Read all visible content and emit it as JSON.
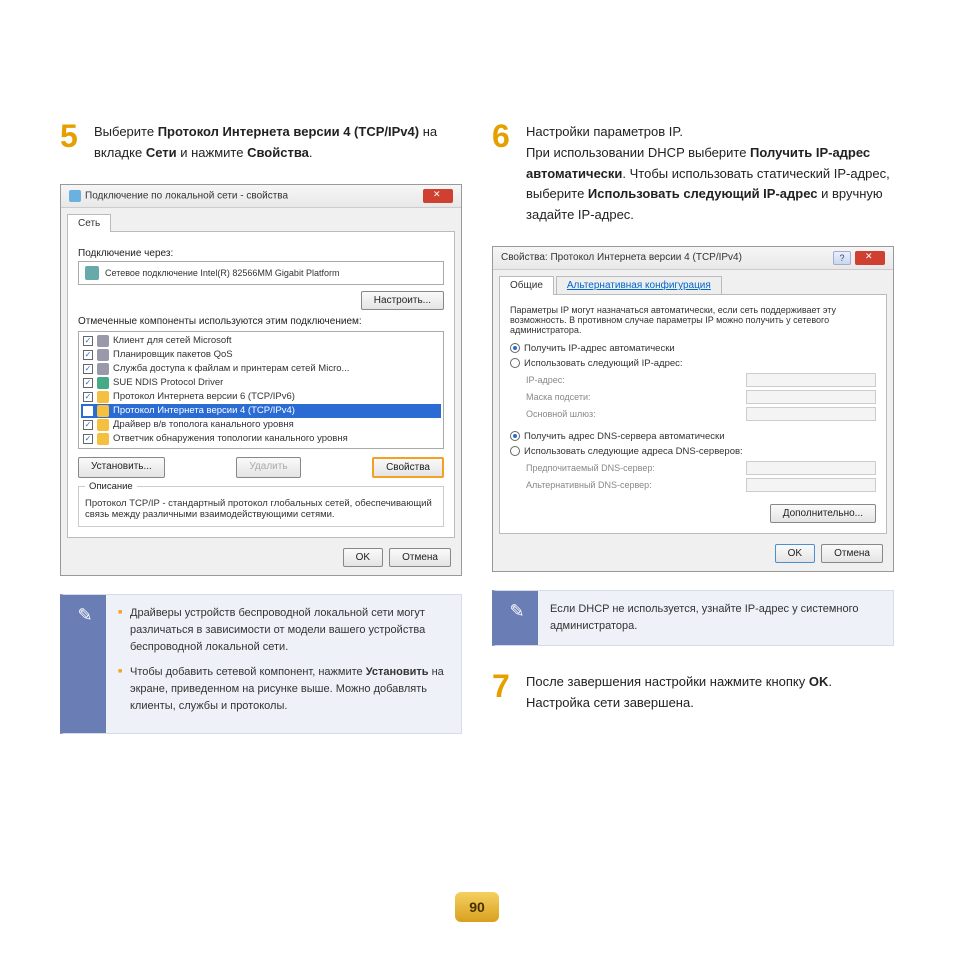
{
  "page_number": "90",
  "step5": {
    "num": "5",
    "text_pre": "Выберите ",
    "bold1": "Протокол Интернета версии 4 (TCP/IPv4)",
    "text_mid": " на вкладке ",
    "bold2": "Сети",
    "text_mid2": " и нажмите ",
    "bold3": "Свойства",
    "text_end": "."
  },
  "step6": {
    "num": "6",
    "line1": "Настройки параметров IP.",
    "text_pre": "При использовании DHCP выберите ",
    "bold1": "Получить IP-адрес автоматически",
    "text_mid": ". Чтобы использовать статический IP-адрес, выберите ",
    "bold2": "Использовать следующий IP-адрес",
    "text_end": " и вручную задайте IP-адрес."
  },
  "step7": {
    "num": "7",
    "text_pre": "После завершения настройки нажмите кнопку ",
    "bold1": "OK",
    "text_mid": ". Настройка сети завершена."
  },
  "dialog1": {
    "title": "Подключение по локальной сети - свойства",
    "tab": "Сеть",
    "label_conn": "Подключение через:",
    "conn": "Сетевое подключение Intel(R) 82566MM Gigabit Platform",
    "btn_configure": "Настроить...",
    "label_components": "Отмеченные компоненты используются этим подключением:",
    "items": [
      "Клиент для сетей Microsoft",
      "Планировщик пакетов QoS",
      "Служба доступа к файлам и принтерам сетей Micro...",
      "SUE NDIS Protocol Driver",
      "Протокол Интернета версии 6 (TCP/IPv6)",
      "Протокол Интернета версии 4 (TCP/IPv4)",
      "Драйвер в/в тополога канального уровня",
      "Ответчик обнаружения топологии канального уровня"
    ],
    "btn_install": "Установить...",
    "btn_remove": "Удалить",
    "btn_props": "Свойства",
    "desc_title": "Описание",
    "desc": "Протокол TCP/IP - стандартный протокол глобальных сетей, обеспечивающий связь между различными взаимодействующими сетями.",
    "btn_ok": "OK",
    "btn_cancel": "Отмена"
  },
  "dialog2": {
    "title": "Свойства: Протокол Интернета версии 4 (TCP/IPv4)",
    "tab1": "Общие",
    "tab2": "Альтернативная конфигурация",
    "intro": "Параметры IP могут назначаться автоматически, если сеть поддерживает эту возможность. В противном случае параметры IP можно получить у сетевого администратора.",
    "radio_auto_ip": "Получить IP-адрес автоматически",
    "radio_manual_ip": "Использовать следующий IP-адрес:",
    "lbl_ip": "IP-адрес:",
    "lbl_mask": "Маска подсети:",
    "lbl_gw": "Основной шлюз:",
    "radio_auto_dns": "Получить адрес DNS-сервера автоматически",
    "radio_manual_dns": "Использовать следующие адреса DNS-серверов:",
    "lbl_dns1": "Предпочитаемый DNS-сервер:",
    "lbl_dns2": "Альтернативный DNS-сервер:",
    "btn_adv": "Дополнительно...",
    "btn_ok": "OK",
    "btn_cancel": "Отмена"
  },
  "note1": {
    "li1_pre": "Драйверы устройств беспроводной локальной сети могут различаться в зависимости от модели вашего устройства беспроводной локальной сети.",
    "li2_pre": "Чтобы добавить сетевой компонент, нажмите ",
    "li2_bold": "Установить",
    "li2_post": " на экране, приведенном на рисунке выше. Можно добавлять клиенты, службы и протоколы."
  },
  "note2": {
    "text": "Если DHCP не используется, узнайте IP-адрес у системного администратора."
  }
}
